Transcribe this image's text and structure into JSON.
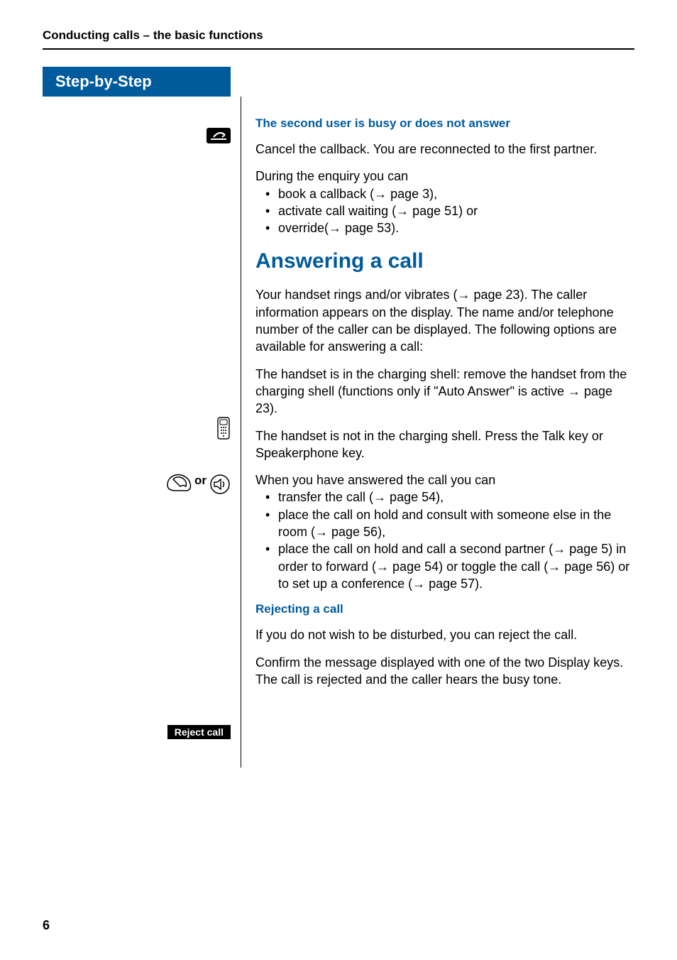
{
  "header": {
    "section_title": "Conducting calls – the basic functions",
    "step_by_step_label": "Step-by-Step"
  },
  "sect_busy": {
    "heading": "The second user is busy or does not answer",
    "cancel_text": "Cancel the callback. You are reconnected to the first partner.",
    "during_enquiry": "During the enquiry you can",
    "bullet1": "book a callback (→ page 3),",
    "bullet2": "activate call waiting (→ page 51) or",
    "bullet3": "override(→ page 53)."
  },
  "answering": {
    "heading": "Answering a call",
    "intro": "Your handset rings and/or vibrates (→ page 23). The caller information appears on the display. The name and/or telephone number of the caller can be displayed. The following options are available for answering a call:",
    "in_shell": "The handset is in the charging shell: remove the handset from the charging shell (functions only if \"Auto Answer\" is active → page 23).",
    "or_label": "or",
    "not_in_shell": "The handset is not in the charging shell. Press the Talk key or Speakerphone key.",
    "answered_intro": "When you have answered the call you can",
    "bullet1": "transfer the call (→ page 54),",
    "bullet2": "place the call on hold and consult with someone else in the room (→ page 56),",
    "bullet3": "place the call on hold and call a second partner (→ page 5) in order to forward (→ page 54) or toggle the call (→ page 56) or to set up a conference (→ page 57)."
  },
  "rejecting": {
    "heading": "Rejecting a call",
    "intro": "If you do not wish to be disturbed, you can reject the call.",
    "reject_button_label": "Reject call",
    "confirm_text": "Confirm the message displayed with one of the two Display keys. The call is rejected and the caller hears the busy tone."
  },
  "page_number": "6"
}
